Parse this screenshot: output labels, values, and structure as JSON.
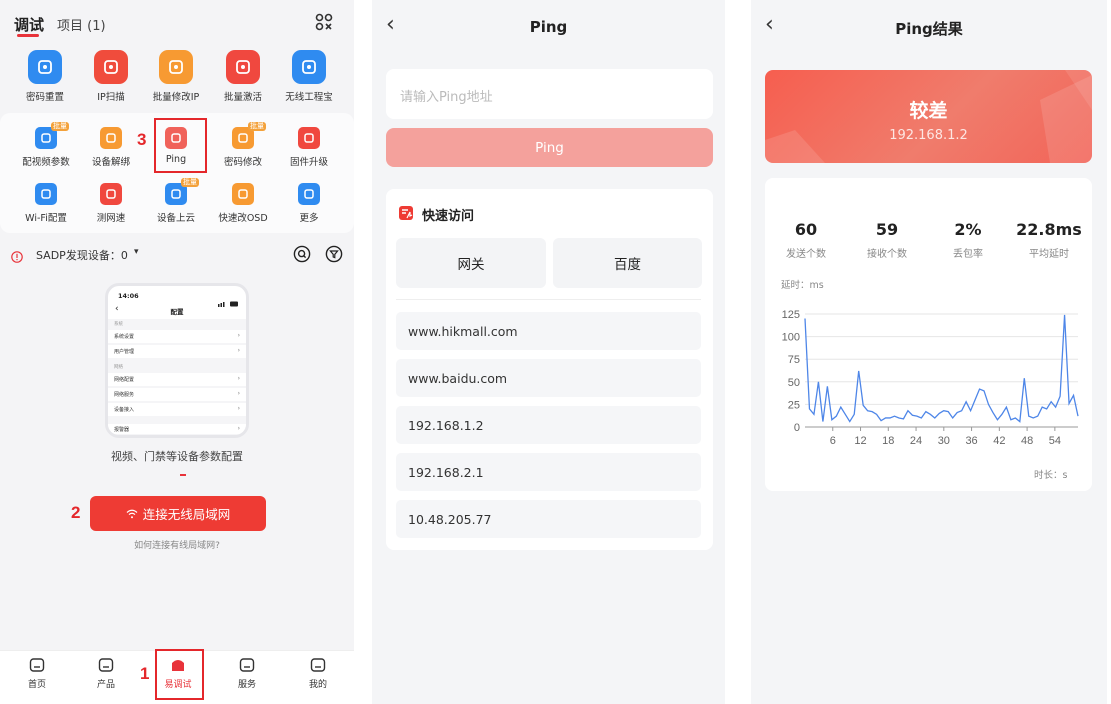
{
  "panel1": {
    "tabs": [
      "调试",
      "项目 (1)"
    ],
    "top_apps": [
      {
        "label": "密码重置",
        "icon": "lock-reset-icon",
        "color": "#2f8bf0"
      },
      {
        "label": "IP扫描",
        "icon": "wifi-scan-icon",
        "color": "#f04c3c"
      },
      {
        "label": "批量修改IP",
        "icon": "ip-edit-icon",
        "color": "#f79a32"
      },
      {
        "label": "批量激活",
        "icon": "touch-activate-icon",
        "color": "#f0483f"
      },
      {
        "label": "无线工程宝",
        "icon": "engineering-tool-icon",
        "color": "#2f8bf0"
      }
    ],
    "tools_row1": [
      {
        "label": "配视频参数",
        "icon": "video-param-icon",
        "color": "#2f8bf0",
        "badge": "批量"
      },
      {
        "label": "设备解绑",
        "icon": "unbind-icon",
        "color": "#f79a32",
        "badge": ""
      },
      {
        "label": "Ping",
        "icon": "ping-icon",
        "color": "#f0625a",
        "badge": ""
      },
      {
        "label": "密码修改",
        "icon": "password-edit-icon",
        "color": "#f79a32",
        "badge": "批量"
      },
      {
        "label": "固件升级",
        "icon": "firmware-upgrade-icon",
        "color": "#f0483f",
        "badge": ""
      }
    ],
    "tools_row2": [
      {
        "label": "Wi-Fi配置",
        "icon": "wifi-config-icon",
        "color": "#2f8bf0",
        "badge": ""
      },
      {
        "label": "测网速",
        "icon": "speedometer-icon",
        "color": "#f0483f",
        "badge": ""
      },
      {
        "label": "设备上云",
        "icon": "cloud-upload-icon",
        "color": "#2f8bf0",
        "badge": "批量"
      },
      {
        "label": "快速改OSD",
        "icon": "osd-icon",
        "color": "#f79a32",
        "badge": ""
      },
      {
        "label": "更多",
        "icon": "more-grid-icon",
        "color": "#2f8bf0",
        "badge": ""
      }
    ],
    "sadp_label": "SADP发现设备：0",
    "phone_time": "14:06",
    "phone_title": "配置",
    "phone_section1": "系统",
    "phone_rows1": [
      "系统设置",
      "用户管理"
    ],
    "phone_section2": "网络",
    "phone_rows2": [
      "网络配置",
      "网络服务",
      "设备接入"
    ],
    "phone_row_extra": "报警器",
    "caption": "视频、门禁等设备参数配置",
    "connect_button": "连接无线局域网",
    "help_link": "如何连接有线局域网?",
    "nav": [
      "首页",
      "产品",
      "易调试",
      "服务",
      "我的"
    ],
    "annotations": [
      "1",
      "2",
      "3"
    ]
  },
  "panel2": {
    "title": "Ping",
    "input_placeholder": "请输入Ping地址",
    "ping_button": "Ping",
    "quick_access_title": "快速访问",
    "quick_chips": [
      "网关",
      "百度"
    ],
    "history": [
      "www.hikmall.com",
      "www.baidu.com",
      "192.168.1.2",
      "192.168.2.1",
      "10.48.205.77"
    ]
  },
  "panel3": {
    "title": "Ping结果",
    "quality": "较差",
    "ip": "192.168.1.2",
    "stats": [
      {
        "value": "60",
        "label": "发送个数"
      },
      {
        "value": "59",
        "label": "接收个数"
      },
      {
        "value": "2%",
        "label": "丢包率"
      },
      {
        "value": "22.8ms",
        "label": "平均延时"
      }
    ],
    "chart_ylabel": "延时：ms",
    "chart_xlabel": "时长：s"
  },
  "colors": {
    "accent": "#e8333a",
    "ping_button": "#f4a19c",
    "chart_line": "#4e86e8"
  },
  "chart_data": {
    "type": "line",
    "title": "",
    "xlabel": "时长：s",
    "ylabel": "延时：ms",
    "xlim": [
      0,
      59
    ],
    "ylim": [
      0,
      125
    ],
    "x_ticks": [
      6,
      12,
      18,
      24,
      30,
      36,
      42,
      48,
      54
    ],
    "y_ticks": [
      0,
      25,
      50,
      75,
      100,
      125
    ],
    "grid": true,
    "series": [
      {
        "values": [
          120,
          20,
          14,
          50,
          6,
          45,
          8,
          12,
          22,
          14,
          6,
          14,
          62,
          24,
          18,
          17,
          14,
          7,
          10,
          10,
          12,
          10,
          9,
          18,
          13,
          12,
          10,
          17,
          14,
          10,
          15,
          18,
          17,
          10,
          16,
          18,
          28,
          18,
          30,
          42,
          40,
          25,
          16,
          8,
          14,
          22,
          8,
          10,
          6,
          54,
          12,
          10,
          12,
          22,
          20,
          28,
          22,
          34,
          124,
          26,
          35,
          12
        ]
      }
    ]
  }
}
